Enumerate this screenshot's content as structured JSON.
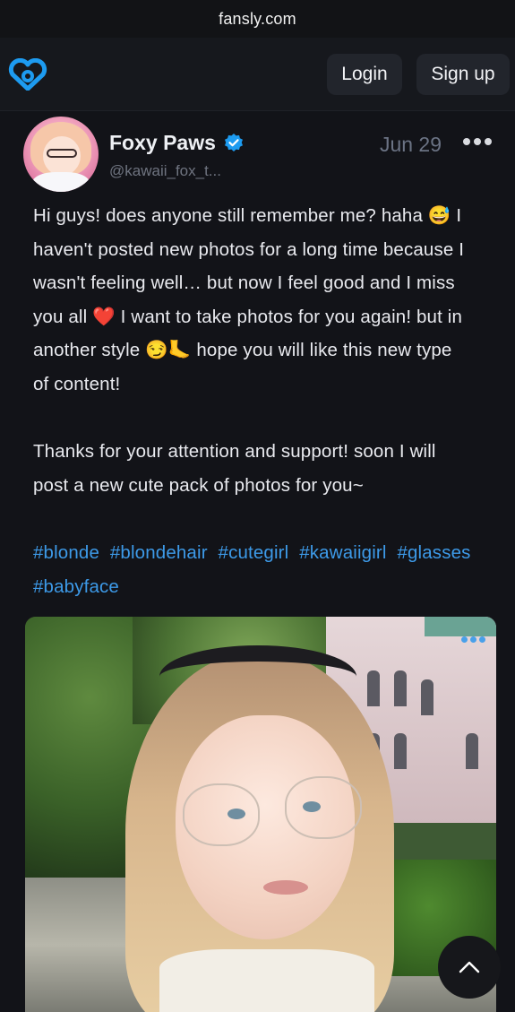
{
  "browser": {
    "url": "fansly.com"
  },
  "header": {
    "login_label": "Login",
    "signup_label": "Sign up",
    "logo_icon": "fansly-heart-logo-icon",
    "accent_color": "#1d9bf0"
  },
  "post": {
    "author": {
      "display_name": "Foxy Paws",
      "handle": "@kawaii_fox_t...",
      "verified_icon": "verified-badge-icon"
    },
    "date": "Jun 29",
    "more_icon": "more-options-icon",
    "body_lines": [
      "Hi guys! does anyone still remember me? haha 😅 I",
      "haven't posted new photos for a long time because I",
      "wasn't feeling well… but now I feel good and I miss",
      "you all ❤️ I want to take photos for you again! but in",
      "another style 😏🦶 hope you will like this new type",
      "of content!"
    ],
    "body_lines_2": [
      "Thanks for your attention and support! soon I will",
      "post a new cute pack of photos for you~"
    ],
    "hashtags": [
      "#blonde",
      "#blondehair",
      "#cutegirl",
      "#kawaiigirl",
      "#glasses",
      "#babyface"
    ],
    "media_menu_icon": "media-more-icon"
  },
  "scroll_top_icon": "chevron-up-icon"
}
